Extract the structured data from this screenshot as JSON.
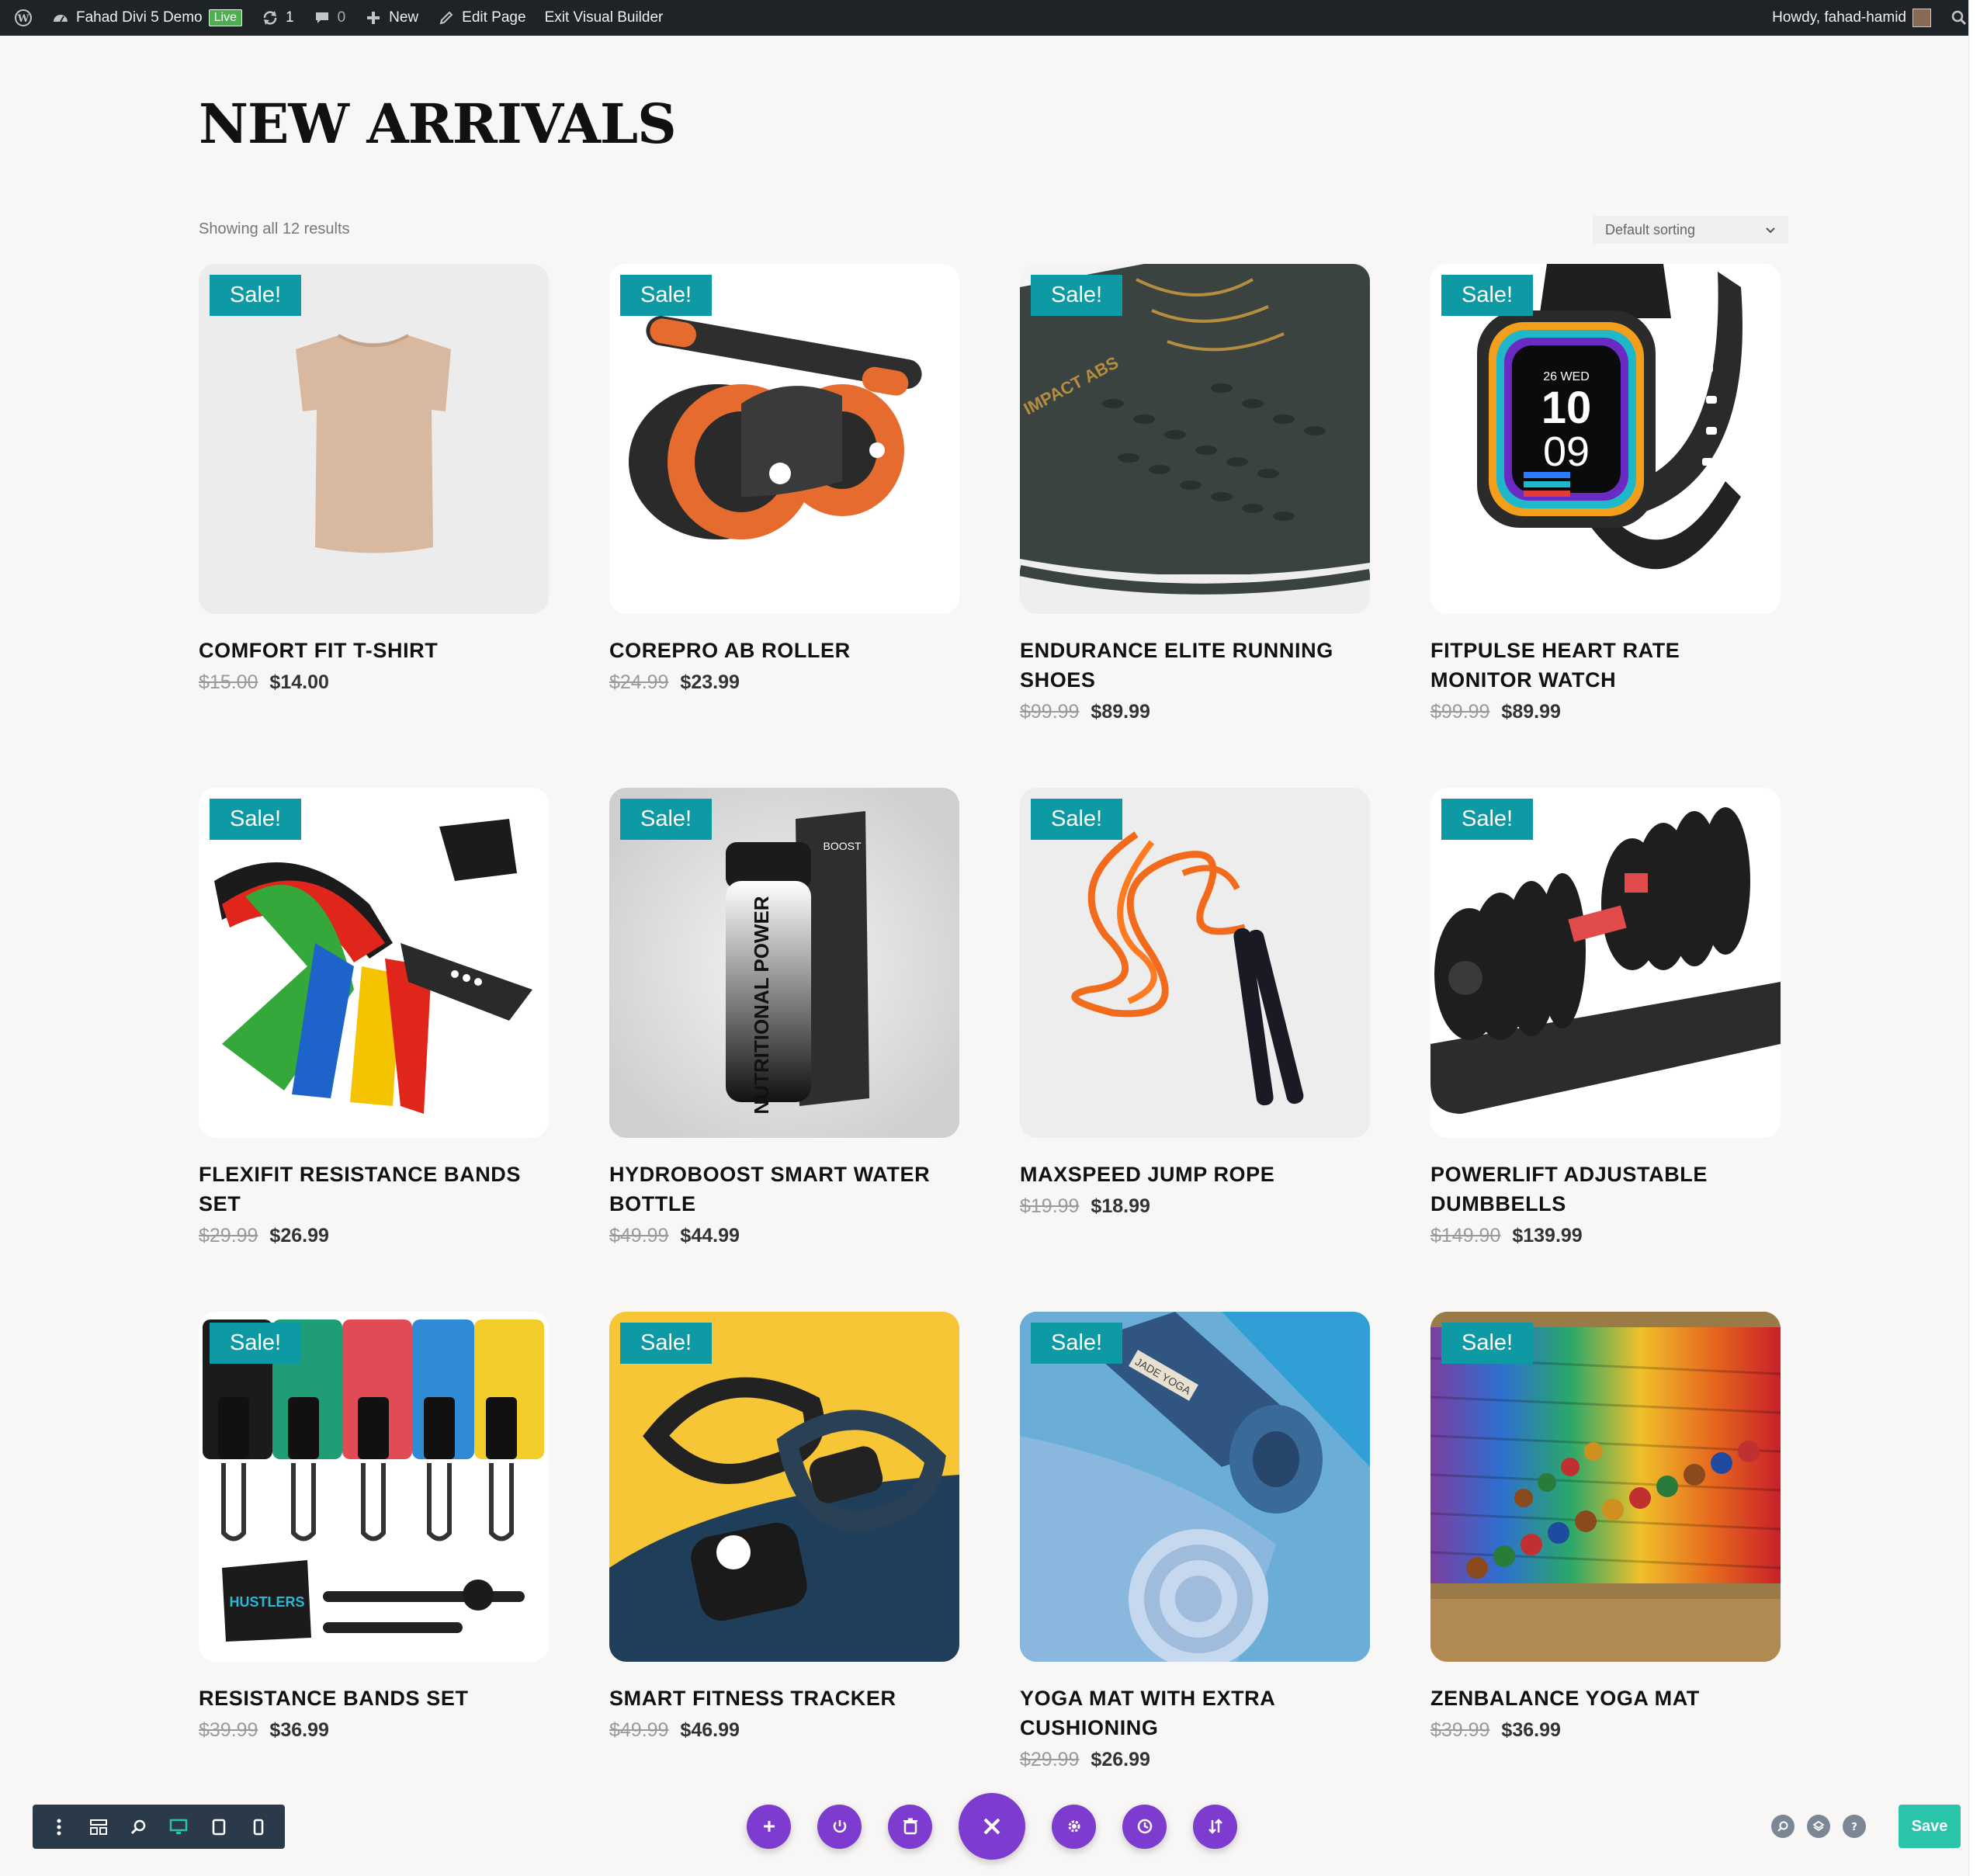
{
  "admin_bar": {
    "site_name": "Fahad Divi 5 Demo",
    "live_badge": "Live",
    "updates_count": "1",
    "comments_count": "0",
    "new_label": "New",
    "edit_page_label": "Edit Page",
    "exit_builder_label": "Exit Visual Builder",
    "howdy_label": "Howdy, fahad-hamid"
  },
  "page": {
    "title": "NEW ARRIVALS",
    "result_count": "Showing all 12 results",
    "sorting": "Default sorting"
  },
  "sale_badge": "Sale!",
  "products": [
    {
      "name": "COMFORT FIT T-SHIRT",
      "old_price": "$15.00",
      "price": "$14.00"
    },
    {
      "name": "COREPRO AB ROLLER",
      "old_price": "$24.99",
      "price": "$23.99"
    },
    {
      "name": "ENDURANCE ELITE RUNNING SHOES",
      "old_price": "$99.99",
      "price": "$89.99"
    },
    {
      "name": "FITPULSE HEART RATE MONITOR WATCH",
      "old_price": "$99.99",
      "price": "$89.99"
    },
    {
      "name": "FLEXIFIT RESISTANCE BANDS SET",
      "old_price": "$29.99",
      "price": "$26.99"
    },
    {
      "name": "HYDROBOOST SMART WATER BOTTLE",
      "old_price": "$49.99",
      "price": "$44.99"
    },
    {
      "name": "MAXSPEED JUMP ROPE",
      "old_price": "$19.99",
      "price": "$18.99"
    },
    {
      "name": "POWERLIFT ADJUSTABLE DUMBBELLS",
      "old_price": "$149.90",
      "price": "$139.99"
    },
    {
      "name": "RESISTANCE BANDS SET",
      "old_price": "$39.99",
      "price": "$36.99"
    },
    {
      "name": "SMART FITNESS TRACKER",
      "old_price": "$49.99",
      "price": "$46.99"
    },
    {
      "name": "YOGA MAT WITH EXTRA CUSHIONING",
      "old_price": "$29.99",
      "price": "$26.99"
    },
    {
      "name": "ZENBALANCE YOGA MAT",
      "old_price": "$39.99",
      "price": "$36.99"
    }
  ],
  "product_image_text": {
    "shoe_brand": "IMPACT ABS",
    "watch_date": "26 WED",
    "watch_hour": "10",
    "watch_minute": "09",
    "bottle_brand": "NUTRITIONAL POWER",
    "bottle_box_label": "BOOST",
    "yoga_mat_brand": "JADE YOGA",
    "bag_brand": "HUSTLERS"
  },
  "toolbar": {
    "save_label": "Save"
  },
  "colors": {
    "sale_badge": "#0d9aa5",
    "builder_purple": "#7e3bd0",
    "save_green": "#29c4a9",
    "admin_bar": "#1d2327"
  }
}
